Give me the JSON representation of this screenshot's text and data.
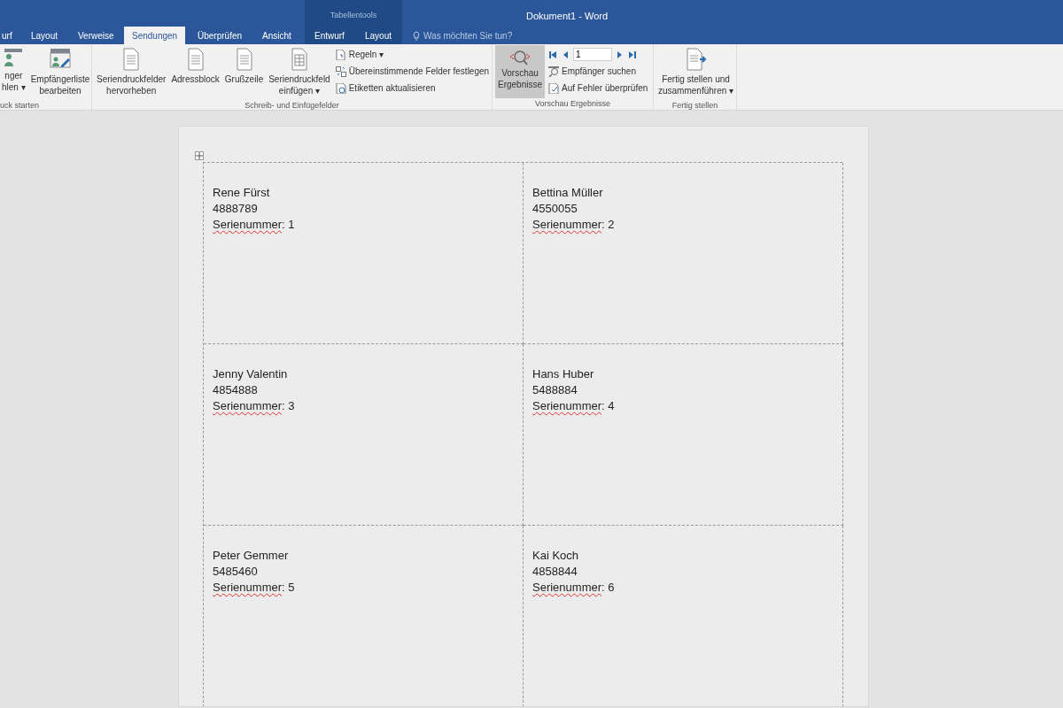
{
  "title_bar": {
    "context_label": "Tabellentools",
    "title": "Dokument1 - Word"
  },
  "tabs": [
    {
      "label": "urf",
      "selected": false
    },
    {
      "label": "Layout",
      "selected": false
    },
    {
      "label": "Verweise",
      "selected": false
    },
    {
      "label": "Sendungen",
      "selected": true
    },
    {
      "label": "Überprüfen",
      "selected": false
    },
    {
      "label": "Ansicht",
      "selected": false
    },
    {
      "label": "Entwurf",
      "selected": false
    },
    {
      "label": "Layout",
      "selected": false
    }
  ],
  "tell_me": {
    "placeholder": "Was möchten Sie tun?"
  },
  "ribbon": {
    "groups": [
      {
        "label": "uck starten",
        "large": [
          {
            "lines": [
              "nger",
              "hlen ▾"
            ]
          },
          {
            "lines": [
              "Empfängerliste",
              "bearbeiten"
            ]
          }
        ]
      },
      {
        "label": "Schreib- und Einfügefelder",
        "large": [
          {
            "lines": [
              "Seriendruckfelder",
              "hervorheben"
            ]
          },
          {
            "lines": [
              "Adressblock"
            ]
          },
          {
            "lines": [
              "Grußzeile"
            ]
          },
          {
            "lines": [
              "Seriendruckfeld",
              "einfügen ▾"
            ]
          }
        ],
        "small": [
          {
            "label": "Regeln ▾"
          },
          {
            "label": "Übereinstimmende Felder festlegen"
          },
          {
            "label": "Etiketten aktualisieren"
          }
        ]
      },
      {
        "label": "Vorschau Ergebnisse",
        "preview": {
          "lines": [
            "Vorschau",
            "Ergebnisse"
          ],
          "selected": true
        },
        "record": {
          "value": "1"
        },
        "small": [
          {
            "label": "Empfänger suchen"
          },
          {
            "label": "Auf Fehler überprüfen"
          }
        ]
      },
      {
        "label": "Fertig stellen",
        "large": [
          {
            "lines": [
              "Fertig stellen und",
              "zusammenführen ▾"
            ]
          }
        ]
      }
    ]
  },
  "labels": [
    {
      "name": "Rene Fürst",
      "number": "4888789",
      "field_label": "Serienummer",
      "misspelled": true,
      "field_value": ": 1"
    },
    {
      "name": "Bettina Müller",
      "number": "4550055",
      "field_label": "Serienummer",
      "misspelled": true,
      "field_value": ": 2"
    },
    {
      "name": "Jenny Valentin",
      "number": "4854888",
      "field_label": "Serienummer",
      "misspelled": true,
      "field_value": ": 3"
    },
    {
      "name": "Hans Huber",
      "number": "5488884",
      "field_label": "Serienummer",
      "misspelled": true,
      "field_value": ": 4"
    },
    {
      "name": "Peter Gemmer",
      "number": "5485460",
      "field_label": "Serienummer",
      "misspelled": true,
      "field_value": ": 5"
    },
    {
      "name": "Kai Koch",
      "number": "4858844",
      "field_label": "Serienummer",
      "misspelled": true,
      "field_value": ": 6"
    }
  ]
}
